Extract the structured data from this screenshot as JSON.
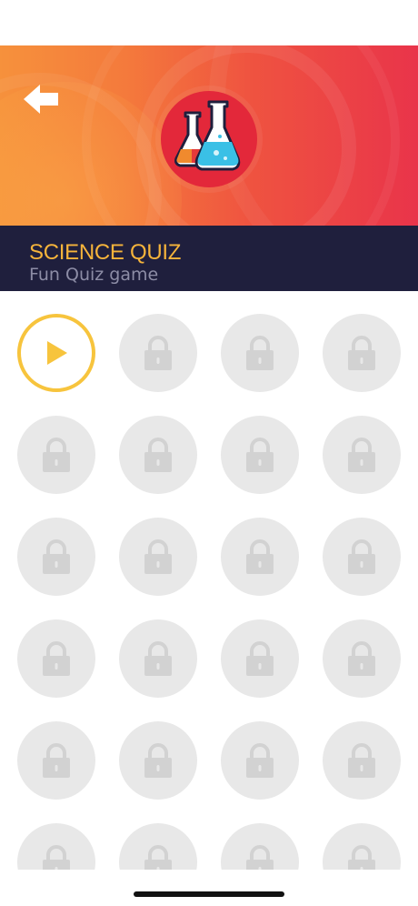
{
  "header": {
    "title": "SCIENCE QUIZ",
    "subtitle": "Fun Quiz game",
    "icons": {
      "back": "back-arrow-icon",
      "emblem": "science-flasks-icon"
    }
  },
  "levels": [
    {
      "status": "unlocked",
      "icon": "play-icon"
    },
    {
      "status": "locked",
      "icon": "lock-icon"
    },
    {
      "status": "locked",
      "icon": "lock-icon"
    },
    {
      "status": "locked",
      "icon": "lock-icon"
    },
    {
      "status": "locked",
      "icon": "lock-icon"
    },
    {
      "status": "locked",
      "icon": "lock-icon"
    },
    {
      "status": "locked",
      "icon": "lock-icon"
    },
    {
      "status": "locked",
      "icon": "lock-icon"
    },
    {
      "status": "locked",
      "icon": "lock-icon"
    },
    {
      "status": "locked",
      "icon": "lock-icon"
    },
    {
      "status": "locked",
      "icon": "lock-icon"
    },
    {
      "status": "locked",
      "icon": "lock-icon"
    },
    {
      "status": "locked",
      "icon": "lock-icon"
    },
    {
      "status": "locked",
      "icon": "lock-icon"
    },
    {
      "status": "locked",
      "icon": "lock-icon"
    },
    {
      "status": "locked",
      "icon": "lock-icon"
    },
    {
      "status": "locked",
      "icon": "lock-icon"
    },
    {
      "status": "locked",
      "icon": "lock-icon"
    },
    {
      "status": "locked",
      "icon": "lock-icon"
    },
    {
      "status": "locked",
      "icon": "lock-icon"
    },
    {
      "status": "locked",
      "icon": "lock-icon"
    },
    {
      "status": "locked",
      "icon": "lock-icon"
    },
    {
      "status": "locked",
      "icon": "lock-icon"
    },
    {
      "status": "locked",
      "icon": "lock-icon"
    }
  ],
  "colors": {
    "accent": "#f6b43b",
    "band": "#1f1f3d",
    "locked": "#e8e8e8",
    "lock_icon": "#d2d2d2",
    "unlocked_ring": "#f7c43d"
  }
}
